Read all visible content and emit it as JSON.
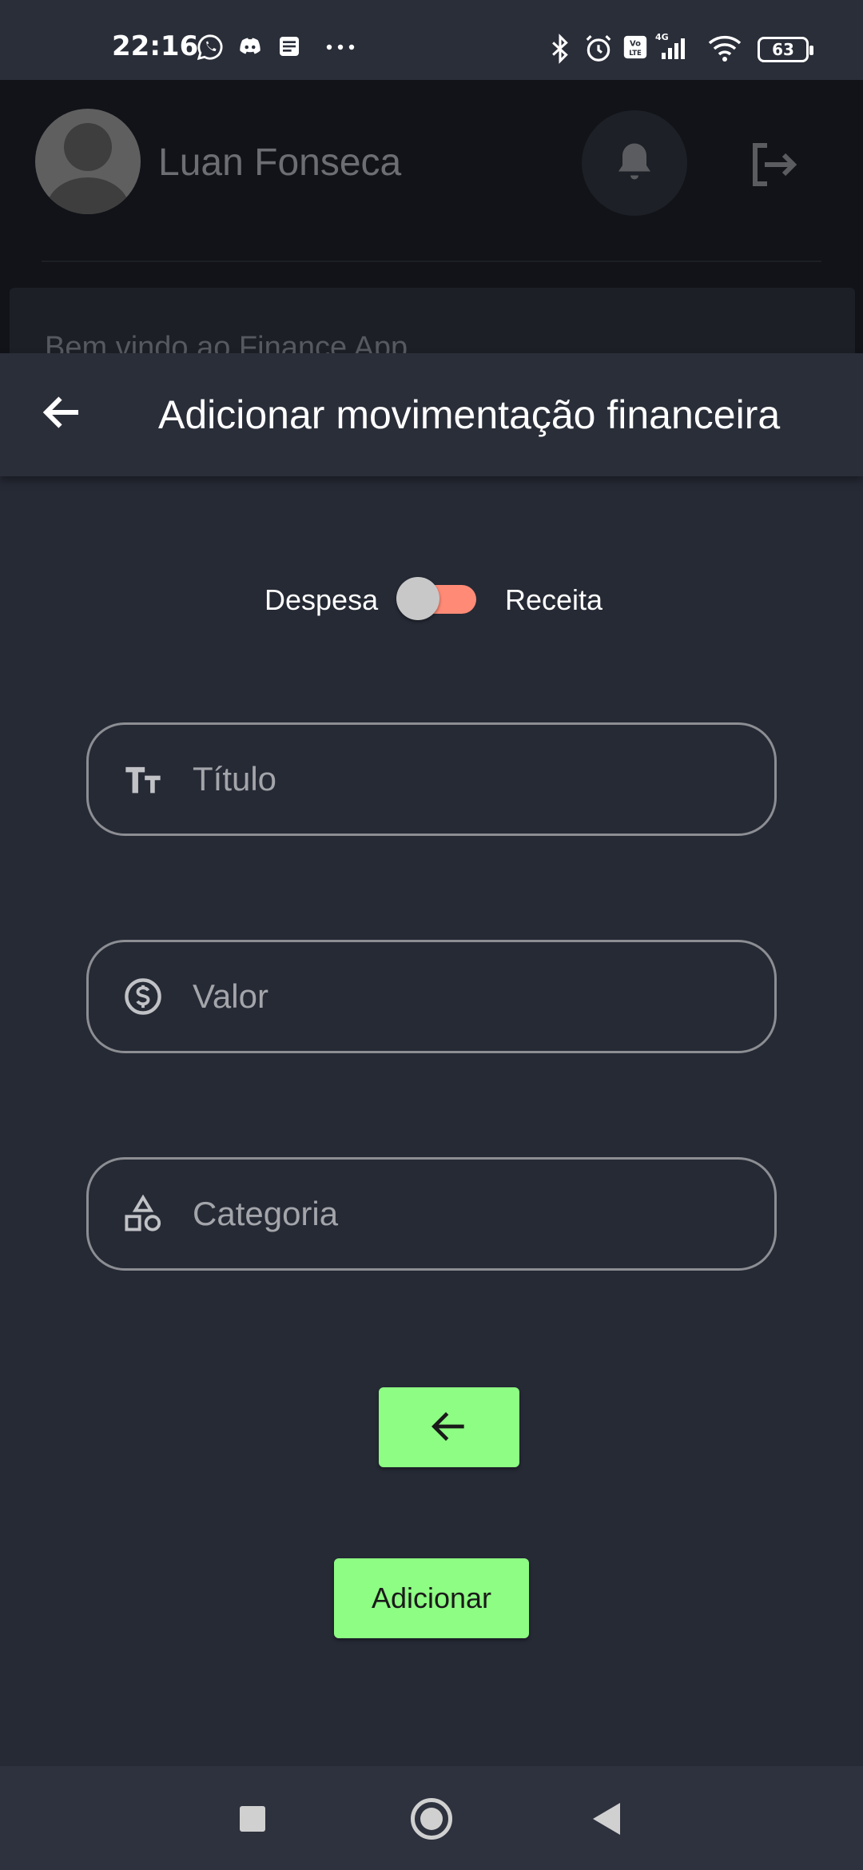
{
  "status_bar": {
    "time": "22:16",
    "battery": "63"
  },
  "header": {
    "user_name": "Luan Fonseca",
    "welcome_text": "Bem vindo ao Finance App"
  },
  "modal": {
    "title": "Adicionar movimentação financeira",
    "toggle": {
      "left_label": "Despesa",
      "right_label": "Receita"
    },
    "fields": {
      "title": {
        "placeholder": "Título",
        "value": ""
      },
      "value": {
        "placeholder": "Valor",
        "value": ""
      },
      "category": {
        "placeholder": "Categoria",
        "value": ""
      }
    },
    "add_button_label": "Adicionar"
  },
  "colors": {
    "accent_green": "#8dfd83",
    "toggle_track": "#ff8b77",
    "background": "#262a35"
  }
}
